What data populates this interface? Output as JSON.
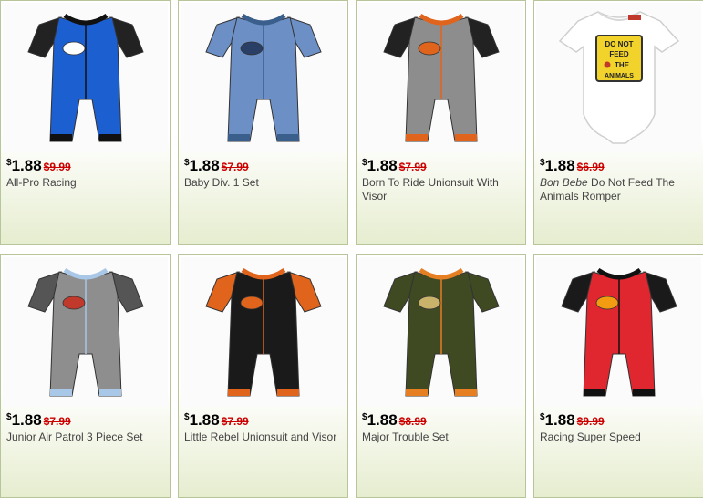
{
  "products": [
    {
      "currency": "$",
      "price": "1.88",
      "was": "$9.99",
      "title_em": "",
      "title": "All-Pro Racing",
      "colors": {
        "body": "#1c5fd0",
        "sleeve": "#222222",
        "trim": "#111111",
        "accent": "#ffffff"
      }
    },
    {
      "currency": "$",
      "price": "1.88",
      "was": "$7.99",
      "title_em": "",
      "title": "Baby Div. 1 Set",
      "colors": {
        "body": "#6c8fc6",
        "sleeve": "#6c8fc6",
        "trim": "#3b5f8c",
        "accent": "#2a3f66"
      }
    },
    {
      "currency": "$",
      "price": "1.88",
      "was": "$7.99",
      "title_em": "",
      "title": "Born To Ride Unionsuit With Visor",
      "colors": {
        "body": "#8d8d8d",
        "sleeve": "#222222",
        "trim": "#e0641c",
        "accent": "#e0641c"
      }
    },
    {
      "currency": "$",
      "price": "1.88",
      "was": "$6.99",
      "title_em": "Bon Bebe",
      "title": " Do Not Feed The Animals Romper",
      "colors": {
        "body": "#ffffff",
        "sleeve": "#ffffff",
        "trim": "#dddddd",
        "accent": "#f2d32b"
      },
      "sign": [
        "DO NOT",
        "FEED",
        "THE",
        "ANIMALS"
      ]
    },
    {
      "currency": "$",
      "price": "1.88",
      "was": "$7.99",
      "title_em": "",
      "title": "Junior Air Patrol 3 Piece Set",
      "colors": {
        "body": "#8e8e8e",
        "sleeve": "#555555",
        "trim": "#a9c7e6",
        "accent": "#c0392b"
      }
    },
    {
      "currency": "$",
      "price": "1.88",
      "was": "$7.99",
      "title_em": "",
      "title": "Little Rebel Unionsuit and Visor",
      "colors": {
        "body": "#1a1a1a",
        "sleeve": "#e0641c",
        "trim": "#e0641c",
        "accent": "#e0641c"
      }
    },
    {
      "currency": "$",
      "price": "1.88",
      "was": "$8.99",
      "title_em": "",
      "title": "Major Trouble Set",
      "colors": {
        "body": "#3f4a22",
        "sleeve": "#3f4a22",
        "trim": "#e67e22",
        "accent": "#c9b26a"
      }
    },
    {
      "currency": "$",
      "price": "1.88",
      "was": "$9.99",
      "title_em": "",
      "title": "Racing Super Speed",
      "colors": {
        "body": "#e0262f",
        "sleeve": "#1a1a1a",
        "trim": "#111111",
        "accent": "#f39c12"
      }
    }
  ]
}
